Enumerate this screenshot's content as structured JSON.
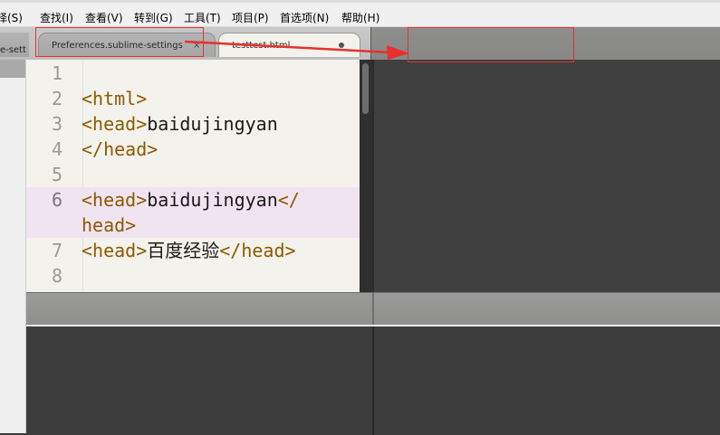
{
  "menu": {
    "items": [
      "选择(S)",
      "查找(I)",
      "查看(V)",
      "转到(G)",
      "工具(T)",
      "项目(P)",
      "首选项(N)",
      "帮助(H)"
    ],
    "first_item_visible": "择(S)"
  },
  "tabs": {
    "edge_tab": "e-sett",
    "tab1": {
      "label": "Preferences.sublime-settings",
      "close": "×"
    },
    "tab2": {
      "label": "testtest.html"
    }
  },
  "editor": {
    "lines": [
      {
        "num": "1"
      },
      {
        "num": "2",
        "code": "<html>"
      },
      {
        "num": "3",
        "tag": "<head>",
        "text": "baidujingyan"
      },
      {
        "num": "4",
        "tag": "</head>"
      },
      {
        "num": "5"
      },
      {
        "num": "6",
        "tag": "<head>",
        "text": "baidujingyan",
        "tag2": "</",
        "wrap": "head>"
      },
      {
        "num": "7",
        "tag": "<head>",
        "cjk": "百度经验",
        "tag2": "</head>"
      },
      {
        "num": "8"
      }
    ],
    "highlighted_line": "6"
  },
  "colors": {
    "annotation_red": "#e8302c",
    "editor_bg": "#f4f2ec",
    "tag_color": "#8a5a00"
  }
}
